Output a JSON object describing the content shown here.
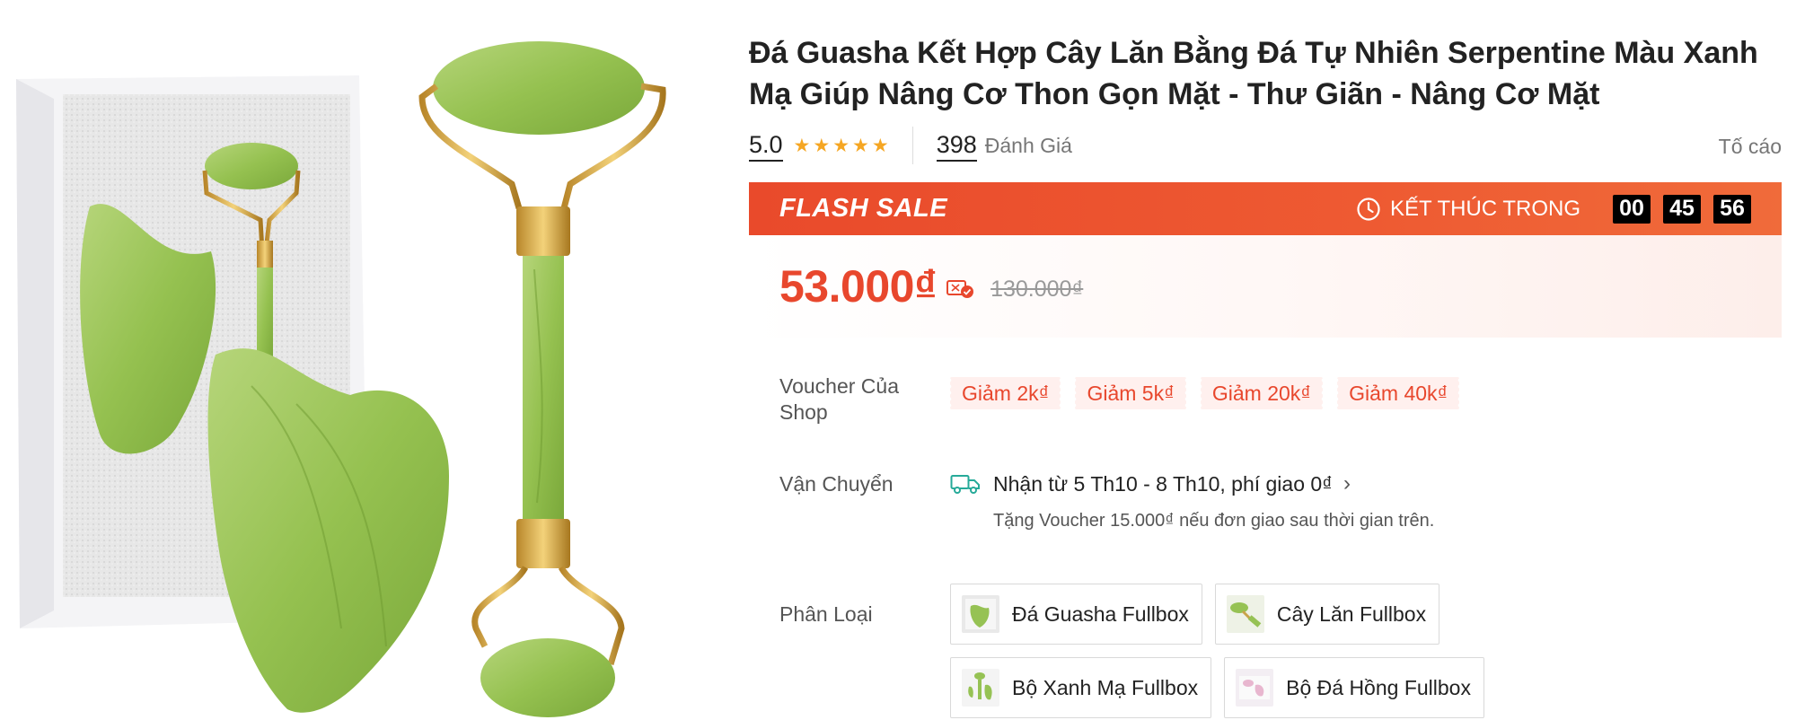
{
  "product": {
    "title": "Đá Guasha Kết Hợp Cây Lăn Bằng Đá Tự Nhiên Serpentine Màu Xanh Mạ Giúp Nâng Cơ Thon Gọn Mặt - Thư Giãn - Nâng Cơ Mặt",
    "rating": "5.0",
    "stars": 5,
    "review_count": "398",
    "review_label": "Đánh Giá",
    "report_label": "Tố cáo"
  },
  "flash_sale": {
    "title": "FLASH SALE",
    "end_label": "KẾT THÚC TRONG",
    "hours": "00",
    "minutes": "45",
    "seconds": "56"
  },
  "price": {
    "current": "53.000₫",
    "original": "130.000₫"
  },
  "voucher": {
    "label": "Voucher Của Shop",
    "items": [
      "Giảm 2k₫",
      "Giảm 5k₫",
      "Giảm 20k₫",
      "Giảm 40k₫"
    ]
  },
  "shipping": {
    "label": "Vận Chuyển",
    "main": "Nhận từ 5 Th10 - 8 Th10, phí giao 0₫",
    "sub": "Tặng Voucher 15.000₫ nếu đơn giao sau thời gian trên."
  },
  "variants": {
    "label": "Phân Loại",
    "items": [
      "Đá Guasha Fullbox",
      "Cây Lăn Fullbox",
      "Bộ Xanh Mạ Fullbox",
      "Bộ Đá Hồng Fullbox"
    ]
  },
  "colors": {
    "accent": "#ee4d2d",
    "star": "#f5a623",
    "jade": "#9cc45a"
  }
}
